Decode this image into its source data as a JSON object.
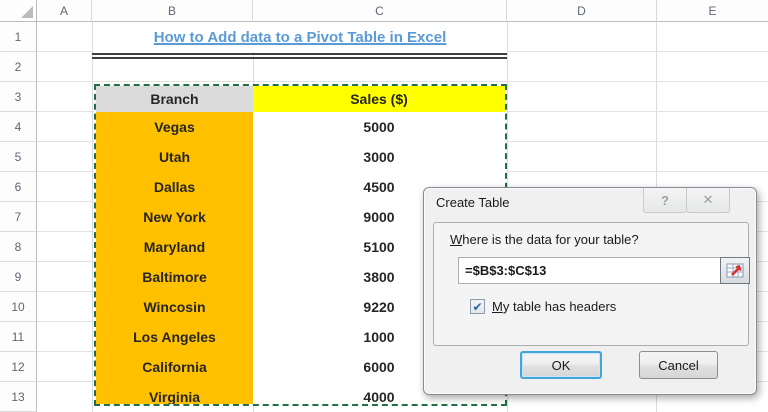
{
  "sheet": {
    "columns": [
      "A",
      "B",
      "C",
      "D",
      "E"
    ],
    "rows": [
      "1",
      "2",
      "3",
      "4",
      "5",
      "6",
      "7",
      "8",
      "9",
      "10",
      "11",
      "12",
      "13"
    ]
  },
  "title": {
    "text": "How to Add data to a Pivot Table in Excel"
  },
  "table": {
    "headers": {
      "branch": "Branch",
      "sales": "Sales ($)"
    },
    "range": "B3:C13",
    "rows": [
      {
        "branch": "Vegas",
        "sales": "5000"
      },
      {
        "branch": "Utah",
        "sales": "3000"
      },
      {
        "branch": "Dallas",
        "sales": "4500"
      },
      {
        "branch": "New York",
        "sales": "9000"
      },
      {
        "branch": "Maryland",
        "sales": "5100"
      },
      {
        "branch": "Baltimore",
        "sales": "3800"
      },
      {
        "branch": "Wincosin",
        "sales": "9220"
      },
      {
        "branch": "Los Angeles",
        "sales": "1000"
      },
      {
        "branch": "California",
        "sales": "6000"
      },
      {
        "branch": "Virginia",
        "sales": "4000"
      }
    ]
  },
  "dialog": {
    "title": "Create Table",
    "help_icon": "?",
    "close_icon": "✕",
    "prompt_mnemonic": "W",
    "prompt_rest": "here is the data for your table?",
    "range_value": "=$B$3:$C$13",
    "checkbox_checked": true,
    "check_icon": "✔",
    "checkbox_mnemonic": "M",
    "checkbox_rest": "y table has headers",
    "ok_label": "OK",
    "cancel_label": "Cancel"
  },
  "colors": {
    "title_blue": "#5B9BD5",
    "branch_orange": "#FFC000",
    "sales_yellow": "#FFFF00",
    "header_gray": "#DBDBDB",
    "selection_green": "#1E7145",
    "ok_focus_blue": "#44A5DC"
  }
}
